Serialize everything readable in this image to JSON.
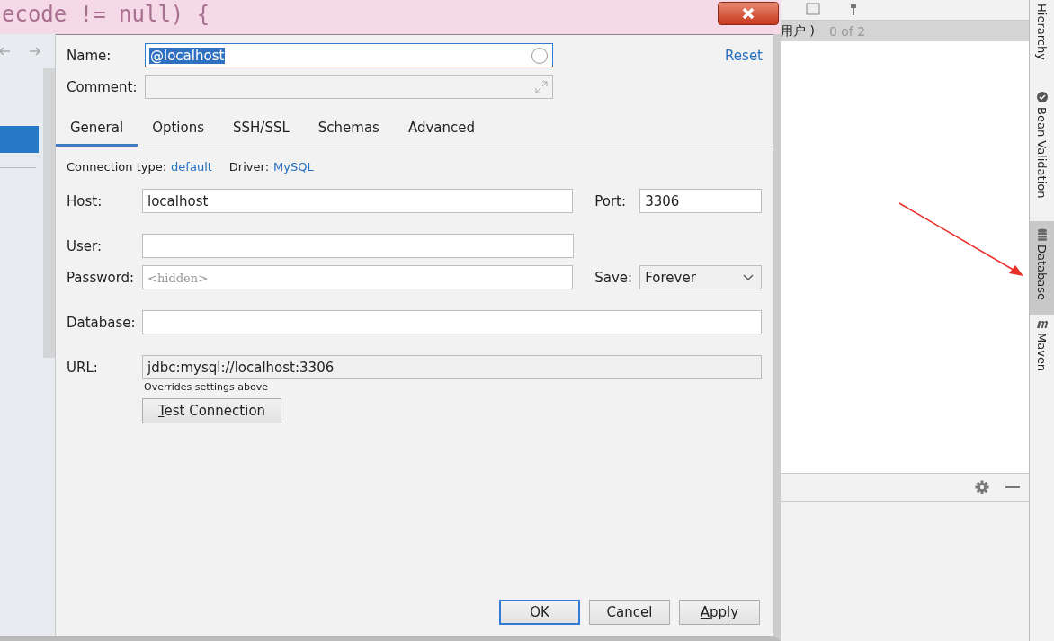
{
  "editor": {
    "code": "ecode != null) {"
  },
  "dialog": {
    "nav": {
      "items": [
        {
          "selected": true
        }
      ]
    },
    "name": {
      "label": "Name:",
      "value": "@localhost"
    },
    "comment": {
      "label": "Comment:"
    },
    "reset": "Reset",
    "tabs": [
      {
        "label": "General",
        "selected": true
      },
      {
        "label": "Options",
        "selected": false
      },
      {
        "label": "SSH/SSL",
        "selected": false
      },
      {
        "label": "Schemas",
        "selected": false
      },
      {
        "label": "Advanced",
        "selected": false
      }
    ],
    "connection_type": {
      "label": "Connection type:",
      "value": "default"
    },
    "driver": {
      "label": "Driver:",
      "value": "MySQL"
    },
    "host": {
      "label": "Host:",
      "value": "localhost"
    },
    "port": {
      "label": "Port:",
      "value": "3306"
    },
    "user": {
      "label": "User:"
    },
    "password": {
      "label": "Password:",
      "placeholder": "<hidden>"
    },
    "save": {
      "label": "Save:",
      "value": "Forever"
    },
    "database": {
      "label": "Database:"
    },
    "url": {
      "label": "URL:",
      "value": "jdbc:mysql://localhost:3306",
      "note": "Overrides settings above"
    },
    "test_button": "Test Connection",
    "buttons": [
      {
        "label": "OK",
        "kind": "default"
      },
      {
        "label": "Cancel",
        "kind": "plain"
      },
      {
        "label": "Apply",
        "kind": "plain"
      }
    ]
  },
  "ide_panel": {
    "header": "用户 )",
    "count": "0 of 2"
  },
  "side_tabs": [
    {
      "label": "Hierarchy",
      "kind": "hierarchy",
      "selected": false
    },
    {
      "label": "Bean Validation",
      "kind": "bean",
      "selected": false
    },
    {
      "label": "Database",
      "kind": "database",
      "selected": true
    },
    {
      "label": "Maven",
      "kind": "maven",
      "selected": false
    }
  ]
}
